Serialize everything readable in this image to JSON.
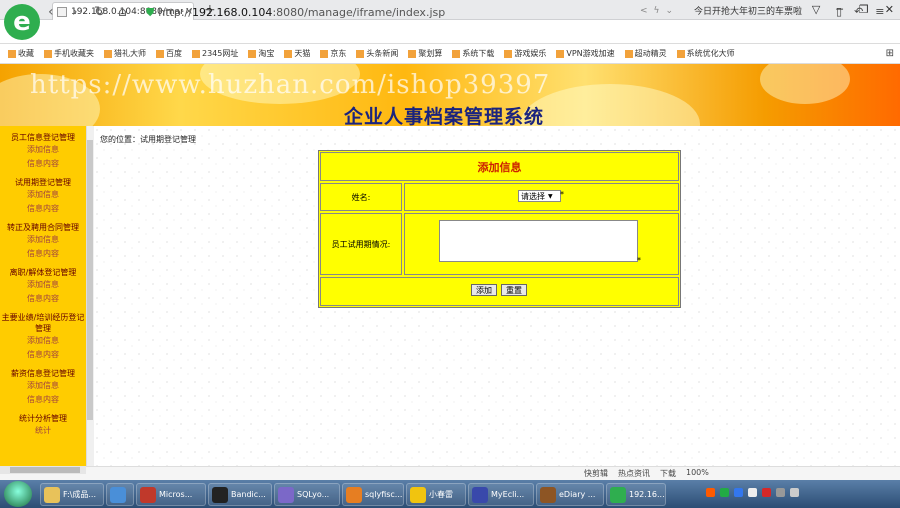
{
  "browser": {
    "tab_title": "192.168.0.104:8080/manage/i",
    "tab_close": "×",
    "new_tab": "+",
    "url_host": "192.168.0.104",
    "url_prefix": "http://",
    "url_path": ":8080/manage/iframe/index.jsp",
    "news_ticker": "今日开抢大年初三的车票啦",
    "window_controls": [
      "▽",
      "─",
      "❐",
      "✕"
    ],
    "nav": {
      "back": "‹",
      "forward": "›",
      "reload": "↻",
      "home": "⌂"
    }
  },
  "bookmarks": [
    "收藏",
    "手机收藏夹",
    "猎礼大师",
    "百度",
    "2345网址",
    "淘宝",
    "天猫",
    "京东",
    "头条新闻",
    "聚划算",
    "系统下载",
    "游戏娱乐",
    "VPN游戏加速",
    "超动精灵",
    "系统优化大师"
  ],
  "banner": {
    "watermark": "https://www.huzhan.com/ishop39397",
    "title": "企业人事档案管理系统"
  },
  "sidebar": {
    "groups": [
      {
        "title": "员工信息登记管理",
        "items": [
          "添加信息",
          "信息内容"
        ]
      },
      {
        "title": "试用期登记管理",
        "items": [
          "添加信息",
          "信息内容"
        ]
      },
      {
        "title": "转正及聘用合同管理",
        "items": [
          "添加信息",
          "信息内容"
        ]
      },
      {
        "title": "离职/解体登记管理",
        "items": [
          "添加信息",
          "信息内容"
        ]
      },
      {
        "title": "主要业绩/培训经历登记管理",
        "items": [
          "添加信息",
          "信息内容"
        ]
      },
      {
        "title": "薪资信息登记管理",
        "items": [
          "添加信息",
          "信息内容"
        ]
      },
      {
        "title": "统计分析管理",
        "items": [
          "统计"
        ]
      }
    ]
  },
  "main": {
    "breadcrumb": "您的位置：试用期登记管理",
    "form": {
      "title": "添加信息",
      "name_label": "姓名:",
      "name_select": "请选择",
      "required_mark": "*",
      "trial_label": "员工试用期情况:",
      "trial_value": "",
      "add_button": "添加",
      "reset_button": "重置"
    }
  },
  "statusbar": {
    "items": [
      "快剪辑",
      "热点资讯",
      "下载",
      "100%"
    ]
  },
  "taskbar": {
    "tasks": [
      {
        "label": "F:\\成品...",
        "color": "#e8c25a"
      },
      {
        "label": "",
        "color": "#4a8fd8"
      },
      {
        "label": "Micros...",
        "color": "#c0392b"
      },
      {
        "label": "Bandic...",
        "color": "#222222"
      },
      {
        "label": "SQLyo...",
        "color": "#7b68c8"
      },
      {
        "label": "sqlyfisc...",
        "color": "#e67e22"
      },
      {
        "label": "小春雷",
        "color": "#f1c40f"
      },
      {
        "label": "MyEcli...",
        "color": "#3949ab"
      },
      {
        "label": "eDiary ...",
        "color": "#8d5524"
      },
      {
        "label": "192.16...",
        "color": "#2fae4f"
      }
    ]
  }
}
